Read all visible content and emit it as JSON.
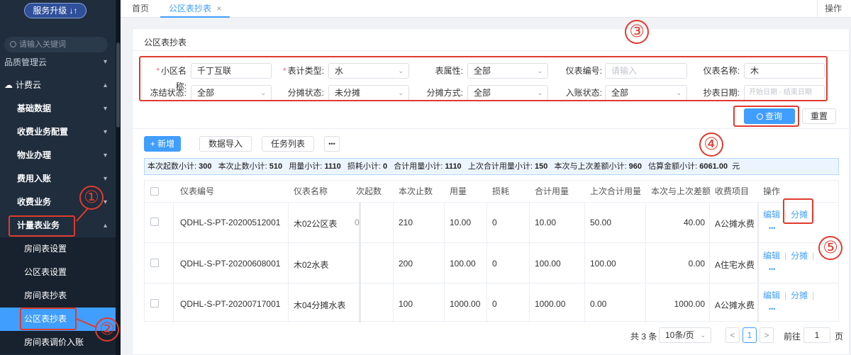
{
  "sidebar": {
    "upgrade": "服务升级",
    "upgrade_icon": "↓↑",
    "search_placeholder": "请输入关键词",
    "items": [
      {
        "label": "品质管理云"
      },
      {
        "label": "计费云"
      },
      {
        "label": "基础数据"
      },
      {
        "label": "收费业务配置"
      },
      {
        "label": "物业办理"
      },
      {
        "label": "费用入账"
      },
      {
        "label": "收费业务"
      },
      {
        "label": "计量表业务"
      },
      {
        "label": "房间表设置"
      },
      {
        "label": "公区表设置"
      },
      {
        "label": "房间表抄表"
      },
      {
        "label": "公区表抄表"
      },
      {
        "label": "房间表调价入账"
      }
    ]
  },
  "tabs": {
    "home": "首页",
    "active": "公区表抄表",
    "close": "×",
    "ops": "操作"
  },
  "panel_title": "公区表抄表",
  "filters": {
    "community_label": "小区名称:",
    "community_value": "千丁互联",
    "meter_type_label": "表计类型:",
    "meter_type_value": "水",
    "attr_label": "表属性:",
    "attr_value": "全部",
    "code_label": "仪表编号:",
    "code_placeholder": "请输入",
    "name_label": "仪表名称:",
    "name_value": "木",
    "freeze_label": "冻结状态:",
    "freeze_value": "全部",
    "split_status_label": "分摊状态:",
    "split_status_value": "未分摊",
    "split_method_label": "分摊方式:",
    "split_method_value": "全部",
    "post_label": "入账状态:",
    "post_value": "全部",
    "date_label": "抄表日期:",
    "date_start": "开始日期",
    "date_sep": "-",
    "date_end": "结束日期",
    "required_mark": "*"
  },
  "buttons": {
    "query": "查询",
    "reset": "重置",
    "add": "新增",
    "import": "数据导入",
    "tasks": "任务列表",
    "more": "•••",
    "add_icon": "+"
  },
  "summary": {
    "start_label": "本次起数小计:",
    "start": "300",
    "end_label": "本次止数小计:",
    "end": "510",
    "usage_label": "用量小计:",
    "usage": "1110",
    "loss_label": "损耗小计:",
    "loss": "0",
    "total_label": "合计用量小计:",
    "total": "1110",
    "last_label": "上次合计用量小计:",
    "last": "150",
    "diff_label": "本次与上次差额小计:",
    "diff": "960",
    "amount_label": "估算金额小计:",
    "amount": "6061.00",
    "unit": "元"
  },
  "table": {
    "headers": [
      "仪表编号",
      "仪表名称",
      "次起数",
      "本次止数",
      "用量",
      "损耗",
      "合计用量",
      "上次合计用量",
      "本次与上次差额",
      "收费项目",
      "操作"
    ],
    "rows": [
      {
        "code": "QDHL-S-PT-20200512001",
        "name": "木02公区表",
        "start": "0",
        "end": "210",
        "usage": "10.00",
        "loss": "0",
        "total": "10.00",
        "last": "50.00",
        "diff": "40.00",
        "item": "A公摊水费"
      },
      {
        "code": "QDHL-S-PT-20200608001",
        "name": "木02水表",
        "start": "",
        "end": "200",
        "usage": "100.00",
        "loss": "0",
        "total": "100.00",
        "last": "100.00",
        "diff": "0.00",
        "item": "A住宅水费"
      },
      {
        "code": "QDHL-S-PT-20200717001",
        "name": "木04分摊水表",
        "start": "",
        "end": "100",
        "usage": "1000.00",
        "loss": "0",
        "total": "1000.00",
        "last": "0.00",
        "diff": "1000.00",
        "item": "A公摊水费"
      }
    ],
    "edit": "编辑",
    "split": "分摊",
    "more": "•••",
    "sep": "|"
  },
  "pager": {
    "total": "共 3 条",
    "size": "10条/页",
    "prev": "<",
    "page": "1",
    "next": ">",
    "goto_label": "前往",
    "goto_value": "1",
    "goto_unit": "页"
  },
  "annotations": [
    "①",
    "②",
    "③",
    "④",
    "⑤"
  ],
  "colors": {
    "sidebar": "#1f2d3d",
    "primary": "#409eff",
    "annotation": "#e03b2e"
  }
}
